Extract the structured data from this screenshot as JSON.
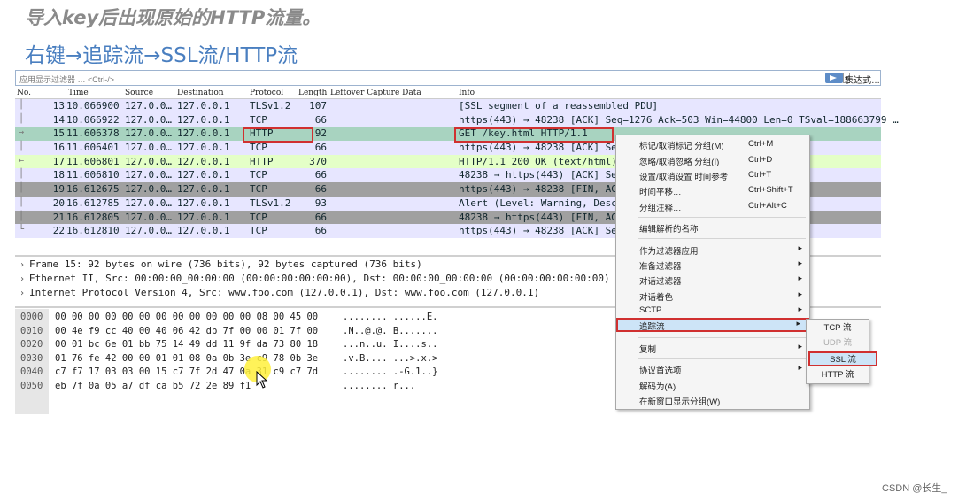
{
  "heading": {
    "line1": "导入key后出现原始的HTTP流量。",
    "line2": "右键→追踪流→SSL流/HTTP流"
  },
  "filter": {
    "placeholder": "应用显示过滤器 … <Ctrl-/>",
    "expression_label": "表达式…"
  },
  "columns": {
    "no": "No.",
    "time": "Time",
    "source": "Source",
    "destination": "Destination",
    "protocol": "Protocol",
    "length": "Length",
    "leftover": "Leftover Capture Data",
    "info": "Info"
  },
  "packets": [
    {
      "no": "13",
      "time": "10.066900",
      "src": "127.0.0…",
      "dst": "127.0.0.1",
      "proto": "TLSv1.2",
      "len": "107",
      "info": "[SSL segment of a reassembled PDU]",
      "bg": "#e7e6ff",
      "fg": "#12272e",
      "mark": "│"
    },
    {
      "no": "14",
      "time": "10.066922",
      "src": "127.0.0…",
      "dst": "127.0.0.1",
      "proto": "TCP",
      "len": "66",
      "info": "https(443) → 48238 [ACK] Seq=1276 Ack=503 Win=44800 Len=0 TSval=188663799 …",
      "bg": "#e7e6ff",
      "fg": "#12272e",
      "mark": "│"
    },
    {
      "no": "15",
      "time": "11.606378",
      "src": "127.0.0…",
      "dst": "127.0.0.1",
      "proto": "HTTP",
      "len": "92",
      "info": "GET /key.html HTTP/1.1",
      "bg": "#a8d3c0",
      "fg": "#12272e",
      "mark": "→"
    },
    {
      "no": "16",
      "time": "11.606401",
      "src": "127.0.0…",
      "dst": "127.0.0.1",
      "proto": "TCP",
      "len": "66",
      "info": "https(443) → 48238 [ACK] Seq…                    =188664184 …",
      "bg": "#e7e6ff",
      "fg": "#12272e",
      "mark": "│"
    },
    {
      "no": "17",
      "time": "11.606801",
      "src": "127.0.0…",
      "dst": "127.0.0.1",
      "proto": "HTTP",
      "len": "370",
      "info": "HTTP/1.1 200 OK  (text/html)",
      "bg": "#e4ffc7",
      "fg": "#12272e",
      "mark": "←"
    },
    {
      "no": "18",
      "time": "11.606810",
      "src": "127.0.0…",
      "dst": "127.0.0.1",
      "proto": "TCP",
      "len": "66",
      "info": "48238 → https(443) [ACK] Seq…                    =188664184 …",
      "bg": "#e7e6ff",
      "fg": "#12272e",
      "mark": "│"
    },
    {
      "no": "19",
      "time": "16.612675",
      "src": "127.0.0…",
      "dst": "127.0.0.1",
      "proto": "TCP",
      "len": "66",
      "info": "https(443) → 48238 [FIN, ACK…                    TSval=18866…",
      "bg": "#a0a0a0",
      "fg": "#12272e",
      "mark": "│"
    },
    {
      "no": "20",
      "time": "16.612785",
      "src": "127.0.0…",
      "dst": "127.0.0.1",
      "proto": "TLSv1.2",
      "len": "93",
      "info": "Alert (Level: Warning, Descr…",
      "bg": "#e7e6ff",
      "fg": "#12272e",
      "mark": "│"
    },
    {
      "no": "21",
      "time": "16.612805",
      "src": "127.0.0…",
      "dst": "127.0.0.1",
      "proto": "TCP",
      "len": "66",
      "info": "48238 → https(443) [FIN, ACK…                    TSval=18866…",
      "bg": "#a0a0a0",
      "fg": "#12272e",
      "mark": "│"
    },
    {
      "no": "22",
      "time": "16.612810",
      "src": "127.0.0…",
      "dst": "127.0.0.1",
      "proto": "TCP",
      "len": "66",
      "info": "https(443) → 48238 [ACK] Seq…                    =188665435 …",
      "bg": "#e7e6ff",
      "fg": "#12272e",
      "mark": "└"
    }
  ],
  "details": [
    "Frame 15: 92 bytes on wire (736 bits), 92 bytes captured (736 bits)",
    "Ethernet II, Src: 00:00:00_00:00:00 (00:00:00:00:00:00), Dst: 00:00:00_00:00:00 (00:00:00:00:00:00)",
    "Internet Protocol Version 4, Src: www.foo.com (127.0.0.1), Dst: www.foo.com (127.0.0.1)"
  ],
  "hex_rows": [
    {
      "off": "0000",
      "bytes": "00 00 00 00 00 00 00 00  00 00 00 00 08 00 45 00",
      "ascii": "........ ......E."
    },
    {
      "off": "0010",
      "bytes": "00 4e f9 cc 40 00 40 06  42 db 7f 00 00 01 7f 00",
      "ascii": ".N..@.@. B......."
    },
    {
      "off": "0020",
      "bytes": "00 01 bc 6e 01 bb 75 14  49 dd 11 9f da 73 80 18",
      "ascii": "...n..u. I....s.."
    },
    {
      "off": "0030",
      "bytes": "01 76 fe 42 00 00 01 01  08 0a 0b 3e c9 78 0b 3e",
      "ascii": ".v.B.... ...>.x.>"
    },
    {
      "off": "0040",
      "bytes": "c7 f7 17 03 03 00 15 c7  7f 2d 47 0a 31 c9 c7 7d",
      "ascii": "........ .-G.1..}"
    },
    {
      "off": "0050",
      "bytes": "eb 7f 0a 05 a7 df ca b5  72 2e 89 f1",
      "ascii": "........ r..."
    }
  ],
  "context_menu": {
    "items": [
      {
        "label": "标记/取消标记 分组(M)",
        "shortcut": "Ctrl+M"
      },
      {
        "label": "忽略/取消忽略 分组(I)",
        "shortcut": "Ctrl+D"
      },
      {
        "label": "设置/取消设置 时间参考",
        "shortcut": "Ctrl+T"
      },
      {
        "label": "时间平移…",
        "shortcut": "Ctrl+Shift+T"
      },
      {
        "label": "分组注释…",
        "shortcut": "Ctrl+Alt+C"
      },
      {
        "label": "编辑解析的名称",
        "shortcut": ""
      },
      {
        "label": "作为过滤器应用",
        "shortcut": ""
      },
      {
        "label": "准备过滤器",
        "shortcut": ""
      },
      {
        "label": "对话过滤器",
        "shortcut": ""
      },
      {
        "label": "对话着色",
        "shortcut": ""
      },
      {
        "label": "SCTP",
        "shortcut": ""
      },
      {
        "label": "追踪流",
        "shortcut": ""
      },
      {
        "label": "复制",
        "shortcut": ""
      },
      {
        "label": "协议首选项",
        "shortcut": ""
      },
      {
        "label": "解码为(A)…",
        "shortcut": ""
      },
      {
        "label": "在新窗口显示分组(W)",
        "shortcut": ""
      }
    ],
    "submenu_arrow": "▸"
  },
  "follow_submenu": {
    "items": [
      "TCP 流",
      "UDP 流",
      "SSL 流",
      "HTTP 流"
    ]
  },
  "watermark": "CSDN @长生_"
}
